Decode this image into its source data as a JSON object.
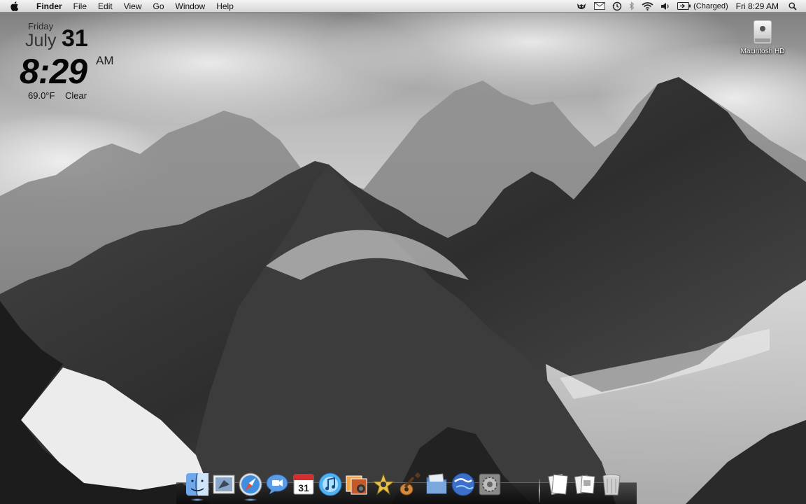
{
  "menubar": {
    "apple_icon": "apple-logo-icon",
    "app_name": "Finder",
    "menus": [
      "File",
      "Edit",
      "View",
      "Go",
      "Window",
      "Help"
    ],
    "status_icons": [
      "growl-icon",
      "mail-icon",
      "time-machine-icon",
      "bluetooth-icon",
      "wifi-icon",
      "volume-icon",
      "battery-icon"
    ],
    "battery_status": "(Charged)",
    "clock": "Fri 8:29 AM",
    "spotlight_icon": "spotlight-search-icon"
  },
  "widget": {
    "day": "Friday",
    "month": "July",
    "date": "31",
    "time": "8:29",
    "ampm": "AM",
    "temperature": "69.0°F",
    "condition": "Clear"
  },
  "desktop": {
    "drive_label": "Macintosh HD",
    "wallpaper": "black-and-white mountain range"
  },
  "dock": {
    "apps": [
      "finder-icon",
      "mail-icon",
      "safari-icon",
      "ichat-icon",
      "ical-icon",
      "itunes-icon",
      "iphoto-icon",
      "imovie-icon",
      "garageband-icon",
      "downloads-stack-icon",
      "google-earth-icon",
      "system-preferences-icon"
    ],
    "running": [
      "finder-icon",
      "safari-icon"
    ],
    "right": [
      "documents-stack-icon",
      "applications-stack-icon",
      "trash-icon"
    ],
    "calendar_date": "31"
  }
}
